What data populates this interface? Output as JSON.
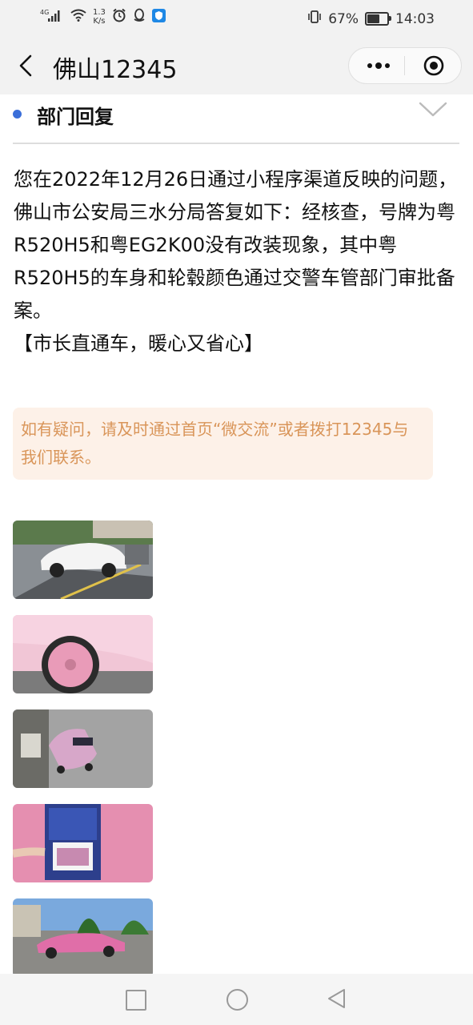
{
  "status_bar": {
    "network": "4G",
    "speed_value": "1.3",
    "speed_unit": "K/s",
    "battery_percent": "67%",
    "battery_level": 0.67,
    "time": "14:03"
  },
  "nav": {
    "title": "佛山12345"
  },
  "section": {
    "title": "部门回复"
  },
  "reply": {
    "lines": [
      "您在2022年12月26日通过小程序渠道反映的问题，",
      "佛山市公安局三水分局答复如下：经核查，号牌为粤R520H5和粤EG2K00没有改装现象，其中粤R520H5的车身和轮毂颜色通过交警车管部门审批备案。",
      "【市长直通车，暖心又省心】"
    ]
  },
  "notice": {
    "text": "如有疑问，请及时通过首页“微交流”或者拨打12345与我们联系。"
  },
  "colors": {
    "accent_dot": "#3b6fd9",
    "notice_bg": "#fdf1e8",
    "notice_text": "#d99559"
  }
}
